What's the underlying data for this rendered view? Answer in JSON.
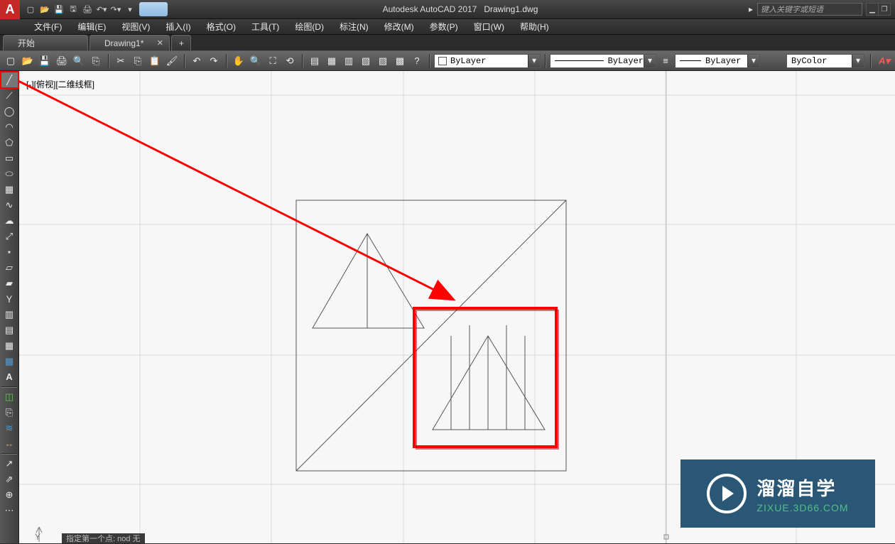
{
  "title": {
    "app": "Autodesk AutoCAD 2017",
    "doc": "Drawing1.dwg",
    "search_placeholder": "键入关键字或短语"
  },
  "menubar": [
    "文件(F)",
    "编辑(E)",
    "视图(V)",
    "插入(I)",
    "格式(O)",
    "工具(T)",
    "绘图(D)",
    "标注(N)",
    "修改(M)",
    "参数(P)",
    "窗口(W)",
    "帮助(H)"
  ],
  "tabs": {
    "start": "开始",
    "active": "Drawing1*",
    "add": "+"
  },
  "toolbar": {
    "layer": "ByLayer",
    "linetype": "ByLayer",
    "lineweight": "ByLayer",
    "linecolor": "ByColor"
  },
  "palette": [
    "line",
    "pline",
    "circle",
    "arc",
    "rect",
    "ellipse",
    "hatch",
    "spline",
    "cloud",
    "cloud2",
    "xline",
    "point",
    "mirror",
    "offset",
    "array",
    "trim",
    "extend",
    "table",
    "text",
    "sep",
    "block",
    "insert",
    "sep",
    "layer",
    "dim",
    "sep",
    "leader",
    "match",
    "sep",
    "more1",
    "more2",
    "more3",
    "more4"
  ],
  "viewport_label": "[-][俯视][二维线框]",
  "status": "指定第一个点:  nod  无",
  "watermark": {
    "big": "溜溜自学",
    "small_left": "ZIXUE.",
    "small_green": "3D66",
    "small_right": ".COM"
  }
}
